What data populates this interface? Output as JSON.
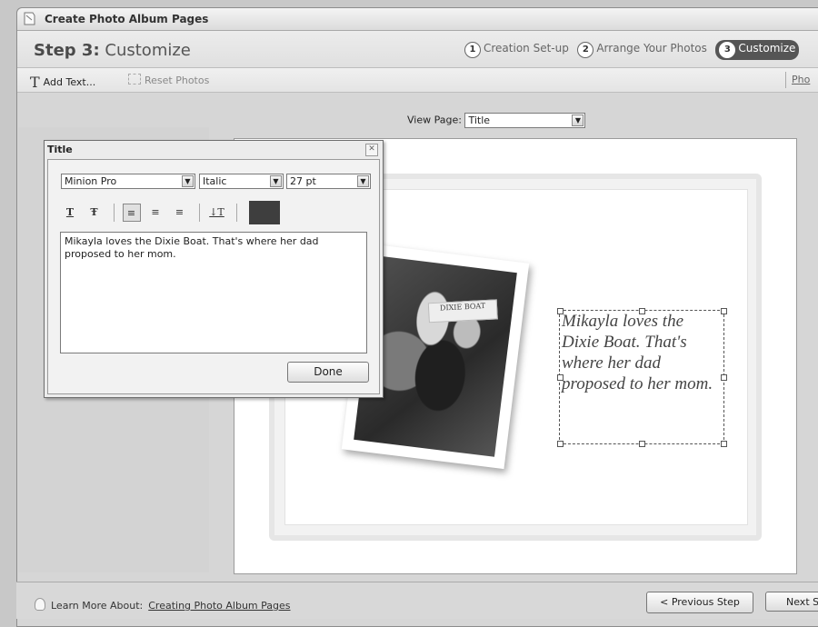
{
  "window": {
    "title": "Create Photo Album Pages"
  },
  "step_header": {
    "step_label": "Step 3:",
    "step_name": "Customize",
    "steps": [
      {
        "num": "1",
        "label": "Creation Set-up"
      },
      {
        "num": "2",
        "label": "Arrange Your Photos"
      },
      {
        "num": "3",
        "label": "Customize"
      }
    ]
  },
  "toolbar": {
    "add_text_icon": "T",
    "add_text_label": "Add Text...",
    "reset_photos_label": "Reset Photos",
    "photos_link": "Pho"
  },
  "view_page": {
    "label": "View Page:",
    "value": "Title"
  },
  "dialog": {
    "title": "Title",
    "font_family": "Minion Pro",
    "font_style": "Italic",
    "font_size": "27 pt",
    "format_buttons": {
      "underline": "T",
      "strike": "Ŧ",
      "align_left": "≡",
      "align_center": "≡",
      "align_right": "≡",
      "baseline": "↓T"
    },
    "text_value": "Mikayla loves the Dixie Boat. That's where her dad proposed to her mom.",
    "done_label": "Done",
    "color": "#3e3e3e"
  },
  "canvas": {
    "caption_lines": [
      "Mikayla loves the",
      "Dixie Boat. That's",
      "where her dad",
      "proposed to her mom."
    ],
    "photo_hat_text": "DIXIE BOAT"
  },
  "footer": {
    "learn_more_label": "Learn More About:",
    "learn_more_link": "Creating Photo Album Pages",
    "previous_label": "< Previous Step",
    "next_label": "Next S"
  }
}
